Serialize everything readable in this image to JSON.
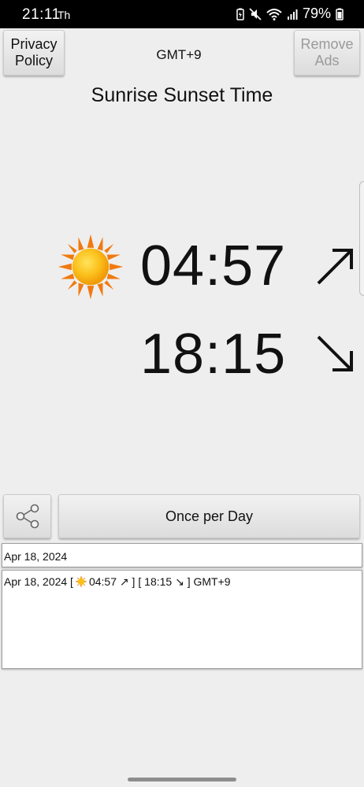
{
  "status_bar": {
    "time": "21:11",
    "extra": "Th",
    "battery": "79%",
    "icons": [
      "battery-saver-icon",
      "mute-icon",
      "wifi-icon",
      "signal-icon",
      "battery-icon"
    ]
  },
  "header": {
    "privacy_label": "Privacy Policy",
    "timezone": "GMT+9",
    "remove_ads_label": "Remove Ads",
    "title": "Sunrise Sunset Time"
  },
  "main": {
    "sun_icon": "sun-icon",
    "sunrise_time": "04:57",
    "sunset_time": "18:15",
    "sunrise_arrow": "↗",
    "sunset_arrow": "↘"
  },
  "controls": {
    "share_icon": "share-icon",
    "frequency_label": "Once per Day"
  },
  "fields": {
    "date_value": "Apr 18, 2024",
    "log_prefix": "Apr 18, 2024 [",
    "log_sunrise": "04:57 ↗ ]",
    "log_sunset": "[ 18:15 ↘ ] GMT+9"
  },
  "colors": {
    "background": "#efeeee",
    "sun_core": "#f8b400",
    "sun_rays": "#f07a10",
    "disabled_text": "#9a9a9a"
  }
}
